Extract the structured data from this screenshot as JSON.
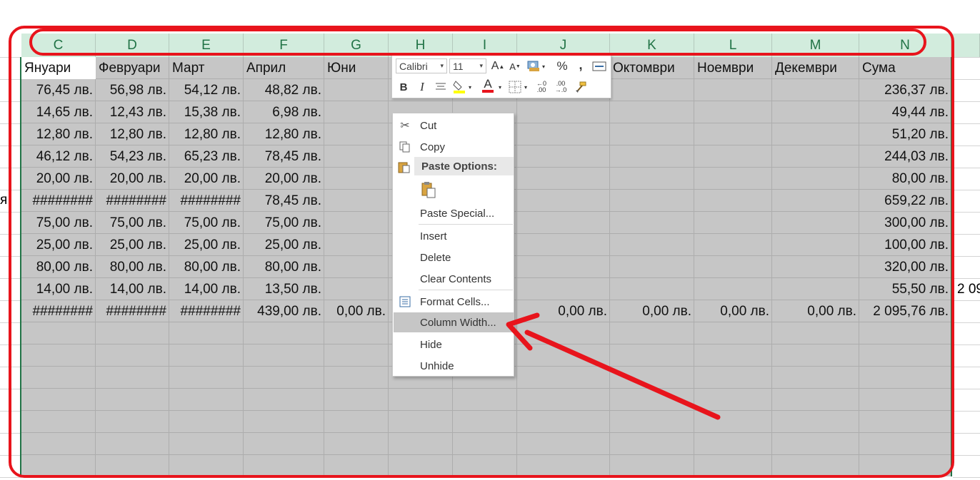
{
  "columns": [
    "C",
    "D",
    "E",
    "F",
    "G",
    "H",
    "I",
    "J",
    "K",
    "L",
    "M",
    "N"
  ],
  "left_fragment": "я",
  "right_fragment": "2 09",
  "headers_row": {
    "C": "Януари",
    "D": "Февруари",
    "E": "Март",
    "F": "Април",
    "G": "Юни",
    "K": "Октомври",
    "L": "Ноември",
    "M": "Декември",
    "N": "Сума"
  },
  "rows": [
    {
      "C": "76,45 лв.",
      "D": "56,98 лв.",
      "E": "54,12 лв.",
      "F": "48,82 лв.",
      "N": "236,37 лв."
    },
    {
      "C": "14,65 лв.",
      "D": "12,43 лв.",
      "E": "15,38 лв.",
      "F": "6,98 лв.",
      "N": "49,44 лв."
    },
    {
      "C": "12,80 лв.",
      "D": "12,80 лв.",
      "E": "12,80 лв.",
      "F": "12,80 лв.",
      "N": "51,20 лв."
    },
    {
      "C": "46,12 лв.",
      "D": "54,23 лв.",
      "E": "65,23 лв.",
      "F": "78,45 лв.",
      "N": "244,03 лв."
    },
    {
      "C": "20,00 лв.",
      "D": "20,00 лв.",
      "E": "20,00 лв.",
      "F": "20,00 лв.",
      "N": "80,00 лв."
    },
    {
      "C": "########",
      "D": "########",
      "E": "########",
      "F": "78,45 лв.",
      "N": "659,22 лв."
    },
    {
      "C": "75,00 лв.",
      "D": "75,00 лв.",
      "E": "75,00 лв.",
      "F": "75,00 лв.",
      "N": "300,00 лв."
    },
    {
      "C": "25,00 лв.",
      "D": "25,00 лв.",
      "E": "25,00 лв.",
      "F": "25,00 лв.",
      "N": "100,00 лв."
    },
    {
      "C": "80,00 лв.",
      "D": "80,00 лв.",
      "E": "80,00 лв.",
      "F": "80,00 лв.",
      "N": "320,00 лв."
    },
    {
      "C": "14,00 лв.",
      "D": "14,00 лв.",
      "E": "14,00 лв.",
      "F": "13,50 лв.",
      "N": "55,50 лв."
    },
    {
      "C": "########",
      "D": "########",
      "E": "########",
      "F": "439,00 лв.",
      "G": "0,00 лв.",
      "J": "0,00 лв.",
      "K": "0,00 лв.",
      "L": "0,00 лв.",
      "M": "0,00 лв.",
      "N": "2 095,76 лв."
    }
  ],
  "mini_toolbar": {
    "font_name": "Calibri",
    "font_size": "11",
    "grow_font": "A",
    "shrink_font": "A",
    "percent": "%",
    "comma": ",",
    "bold": "B",
    "italic": "I",
    "font_color": "A",
    "inc_decimal_top": "←0",
    "inc_decimal_bottom": ".00",
    "dec_decimal_top": ".00",
    "dec_decimal_bottom": "→.0"
  },
  "context_menu": {
    "cut": "Cut",
    "copy": "Copy",
    "paste_options": "Paste Options:",
    "paste_special": "Paste Special...",
    "insert": "Insert",
    "delete": "Delete",
    "clear_contents": "Clear Contents",
    "format_cells": "Format Cells...",
    "column_width": "Column Width...",
    "hide": "Hide",
    "unhide": "Unhide"
  },
  "colors": {
    "header_bg": "#d2ecdd",
    "header_text": "#217346",
    "selection_gray": "#c6c6c6",
    "annotation_red": "#e8141c"
  }
}
